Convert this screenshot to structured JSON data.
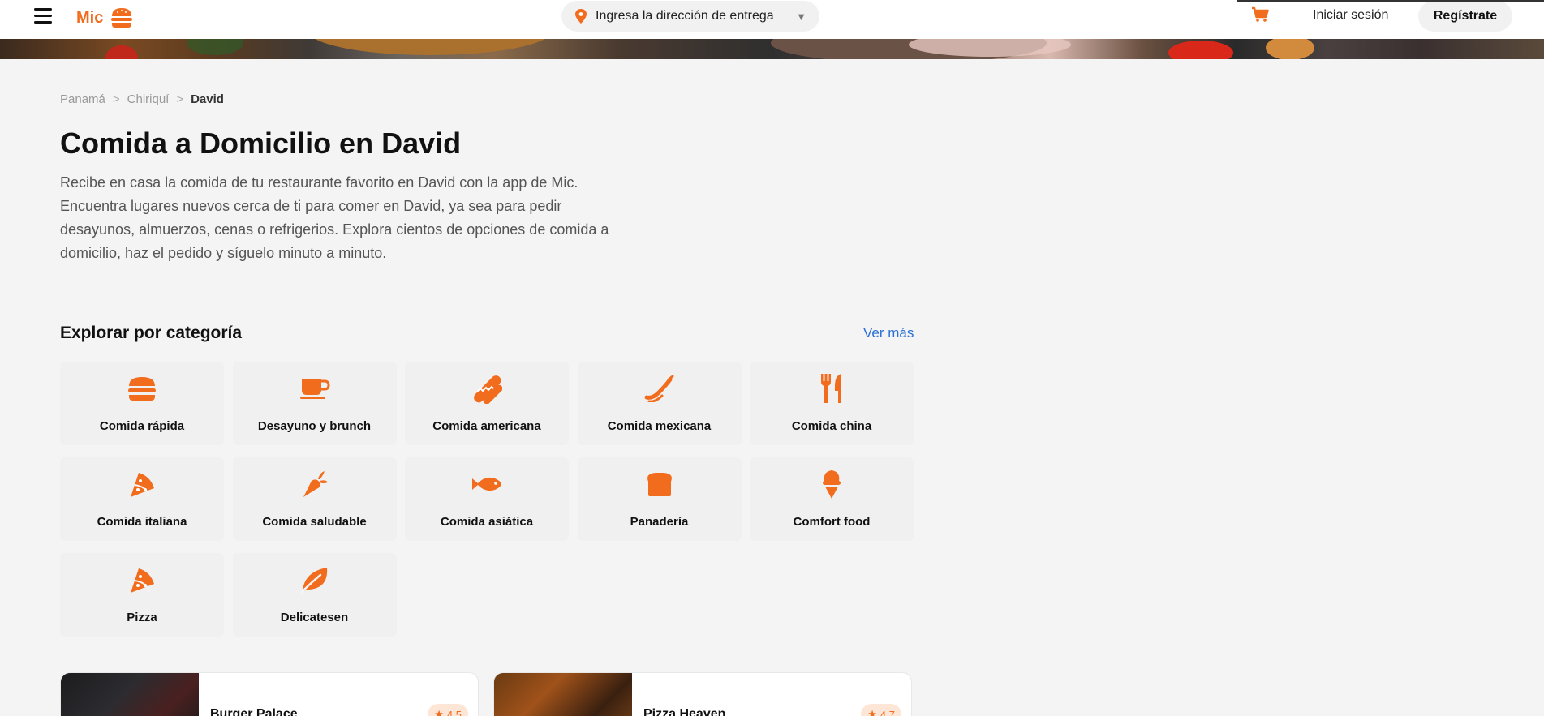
{
  "header": {
    "logo_text": "Mic",
    "address_placeholder": "Ingresa la dirección de entrega",
    "login_label": "Iniciar sesión",
    "register_label": "Regístrate"
  },
  "breadcrumb": [
    {
      "label": "Panamá"
    },
    {
      "label": "Chiriquí"
    },
    {
      "label": "David"
    }
  ],
  "breadcrumb_separator": ">",
  "page": {
    "title": "Comida a Domicilio en David",
    "intro": "Recibe en casa la comida de tu restaurante favorito en David con la app de Mic. Encuentra lugares nuevos cerca de ti para comer en David, ya sea para pedir desayunos, almuerzos, cenas o refrigerios. Explora cientos de opciones de comida a domicilio, haz el pedido y síguelo minuto a minuto."
  },
  "categories_section": {
    "title": "Explorar por categoría",
    "see_more": "Ver más",
    "items": [
      {
        "label": "Comida rápida",
        "icon": "burger-icon"
      },
      {
        "label": "Desayuno y brunch",
        "icon": "coffee-cup-icon"
      },
      {
        "label": "Comida americana",
        "icon": "hotdog-icon"
      },
      {
        "label": "Comida mexicana",
        "icon": "pepper-icon"
      },
      {
        "label": "Comida china",
        "icon": "utensils-icon"
      },
      {
        "label": "Comida italiana",
        "icon": "pizza-slice-icon"
      },
      {
        "label": "Comida saludable",
        "icon": "carrot-icon"
      },
      {
        "label": "Comida asiática",
        "icon": "fish-icon"
      },
      {
        "label": "Panadería",
        "icon": "bread-icon"
      },
      {
        "label": "Comfort food",
        "icon": "ice-cream-icon"
      },
      {
        "label": "Pizza",
        "icon": "pizza-slice-icon"
      },
      {
        "label": "Delicatesen",
        "icon": "leaf-icon"
      }
    ]
  },
  "restaurants": [
    {
      "name": "Burger Palace",
      "rating": "4.5"
    },
    {
      "name": "Pizza Heaven",
      "rating": "4.7"
    }
  ],
  "colors": {
    "accent": "#f26c1d",
    "link": "#2a6fd6",
    "background": "#f4f4f4"
  }
}
